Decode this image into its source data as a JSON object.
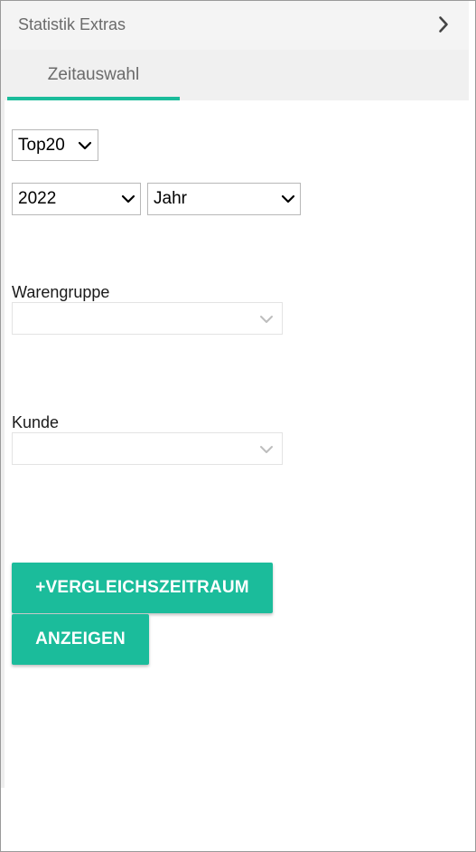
{
  "header": {
    "title": "Statistik Extras",
    "expand_icon": "chevron-right-icon"
  },
  "tabs": [
    {
      "label": "Zeitauswahl",
      "active": true
    }
  ],
  "filters": {
    "top_select": {
      "value": "Top20"
    },
    "year_select": {
      "value": "2022"
    },
    "period_select": {
      "value": "Jahr"
    }
  },
  "warengruppe": {
    "label": "Warengruppe",
    "value": ""
  },
  "kunde": {
    "label": "Kunde",
    "value": ""
  },
  "buttons": {
    "compare_label": "+VERGLEICHSZEITRAUM",
    "show_label": "ANZEIGEN"
  },
  "colors": {
    "accent": "#1bbc9b",
    "header_bg": "#f4f4f4",
    "tabbar_bg": "#f0f0f0",
    "muted_text": "#6b6b6b"
  }
}
